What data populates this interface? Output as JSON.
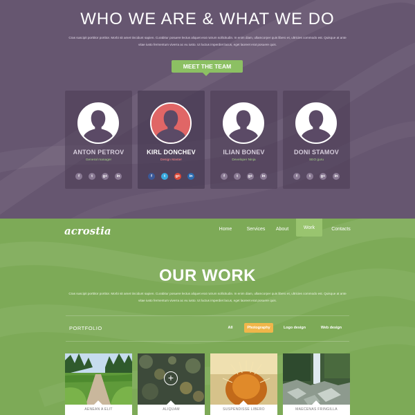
{
  "team": {
    "title": "WHO WE ARE & WHAT WE DO",
    "lead": "Cras suscipit porttitor portitor. Morbi sit amet tincidunt sapien. Curabitur posuere lectus aliquet erat rutrum sollicitudin. In enim diam, ullamcorper quis libero et, ultricies commodo est. Quisque at ante vitae iusto fermentum viverra ac eu iusto. Ut luctus imperdiet lacus, eget laoreet erat posuere quis.",
    "cta": "MEET THE TEAM",
    "members": [
      {
        "name": "ANTON PETROV",
        "role": "General manager",
        "featured": false
      },
      {
        "name": "KIRL DONCHEV",
        "role": "Design Master",
        "featured": true
      },
      {
        "name": "ILIAN BONEV",
        "role": "Developer Ninja",
        "featured": false
      },
      {
        "name": "DONI STAMOV",
        "role": "SEO guru",
        "featured": false
      }
    ],
    "social_glyphs": {
      "facebook": "f",
      "twitter": "t",
      "google_plus": "g+",
      "linkedin": "in"
    },
    "social_colors": {
      "facebook": "#3b5998",
      "twitter": "#39a9de",
      "google_plus": "#dd4b39",
      "linkedin": "#2b6cb0",
      "muted": "#8a7a94"
    }
  },
  "nav": {
    "logo": "acrostia",
    "items": [
      {
        "label": "Home",
        "active": false
      },
      {
        "label": "Services",
        "active": false
      },
      {
        "label": "About",
        "active": false
      },
      {
        "label": "Work",
        "active": true
      },
      {
        "label": "Contacts",
        "active": false
      }
    ]
  },
  "work": {
    "title": "OUR WORK",
    "lead": "Cras suscipit porttitor portitor. Morbi sit amet tincidunt sapien. Curabitur posuere lectus aliquet erat rutrum sollicitudin. In enim diam, ullamcorper quis libero et, ultricies commodo est. Quisque at ante vitae iusto fermentum viverra ac eu iusto. Ut luctus imperdiet lacus, eget laoreet erat posuere quis.",
    "portfolio_label": "PORTFOLIO",
    "filters": [
      {
        "label": "All",
        "active": false
      },
      {
        "label": "Photography",
        "active": true
      },
      {
        "label": "Logo design",
        "active": false
      },
      {
        "label": "Web design",
        "active": false
      }
    ],
    "items": [
      {
        "label": "AENEAN A ELIT",
        "image": "forest-path"
      },
      {
        "label": "ALIQUAM",
        "image": "bokeh-lights"
      },
      {
        "label": "SUSPENDISSE LIBERO",
        "image": "cactus-closeup"
      },
      {
        "label": "MAECENAS FRINGILLA",
        "image": "waterfall-rocks"
      }
    ]
  },
  "colors": {
    "purple_bg": "#665670",
    "green_bg": "#7daa57",
    "accent_green": "#8cc063",
    "accent_orange": "#f0b64a",
    "featured_red": "#e06666"
  }
}
